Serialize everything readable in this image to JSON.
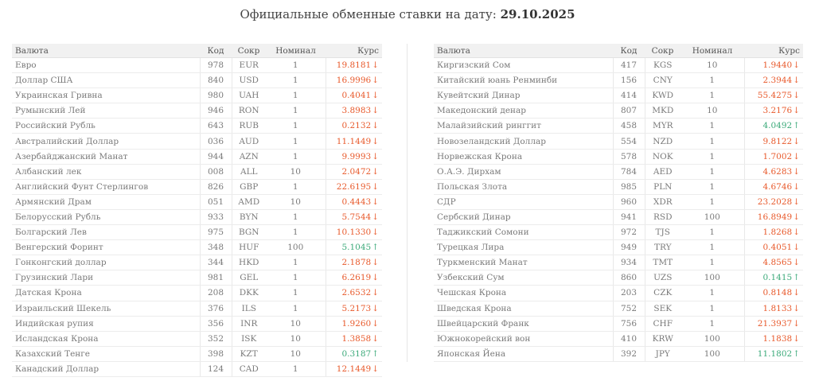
{
  "header": {
    "title_prefix": "Официальные обменные ставки на дату: ",
    "date": "29.10.2025"
  },
  "columns": {
    "name": "Валюта",
    "code": "Код",
    "abbr": "Сокр",
    "nominal": "Номинал",
    "rate": "Курс"
  },
  "colors": {
    "down": "#e85a2c",
    "up": "#3caa7a"
  },
  "icons": {
    "down": "arrow-down-icon",
    "up": "arrow-up-icon"
  },
  "left_table": [
    {
      "name": "Евро",
      "code": "978",
      "abbr": "EUR",
      "nominal": "1",
      "rate": "19.8181",
      "dir": "down",
      "arrow": "↓"
    },
    {
      "name": "Доллар США",
      "code": "840",
      "abbr": "USD",
      "nominal": "1",
      "rate": "16.9996",
      "dir": "down",
      "arrow": "↓"
    },
    {
      "name": "Украинская Гривна",
      "code": "980",
      "abbr": "UAH",
      "nominal": "1",
      "rate": "0.4041",
      "dir": "down",
      "arrow": "↓"
    },
    {
      "name": "Румынский Лей",
      "code": "946",
      "abbr": "RON",
      "nominal": "1",
      "rate": "3.8983",
      "dir": "down",
      "arrow": "↓"
    },
    {
      "name": "Российский Рубль",
      "code": "643",
      "abbr": "RUB",
      "nominal": "1",
      "rate": "0.2132",
      "dir": "down",
      "arrow": "↓"
    },
    {
      "name": "Австралийский Доллар",
      "code": "036",
      "abbr": "AUD",
      "nominal": "1",
      "rate": "11.1449",
      "dir": "down",
      "arrow": "↓"
    },
    {
      "name": "Азербайджанский Манат",
      "code": "944",
      "abbr": "AZN",
      "nominal": "1",
      "rate": "9.9993",
      "dir": "down",
      "arrow": "↓"
    },
    {
      "name": "Албанский лек",
      "code": "008",
      "abbr": "ALL",
      "nominal": "10",
      "rate": "2.0472",
      "dir": "down",
      "arrow": "↓"
    },
    {
      "name": "Английский Фунт Стерлингов",
      "code": "826",
      "abbr": "GBP",
      "nominal": "1",
      "rate": "22.6195",
      "dir": "down",
      "arrow": "↓"
    },
    {
      "name": "Армянский Драм",
      "code": "051",
      "abbr": "AMD",
      "nominal": "10",
      "rate": "0.4443",
      "dir": "down",
      "arrow": "↓"
    },
    {
      "name": "Белорусский Рубль",
      "code": "933",
      "abbr": "BYN",
      "nominal": "1",
      "rate": "5.7544",
      "dir": "down",
      "arrow": "↓"
    },
    {
      "name": "Болгарский Лев",
      "code": "975",
      "abbr": "BGN",
      "nominal": "1",
      "rate": "10.1330",
      "dir": "down",
      "arrow": "↓"
    },
    {
      "name": "Венгерский Форинт",
      "code": "348",
      "abbr": "HUF",
      "nominal": "100",
      "rate": "5.1045",
      "dir": "up",
      "arrow": "↑"
    },
    {
      "name": "Гонконгский доллар",
      "code": "344",
      "abbr": "HKD",
      "nominal": "1",
      "rate": "2.1878",
      "dir": "down",
      "arrow": "↓"
    },
    {
      "name": "Грузинский Лари",
      "code": "981",
      "abbr": "GEL",
      "nominal": "1",
      "rate": "6.2619",
      "dir": "down",
      "arrow": "↓"
    },
    {
      "name": "Датская Крона",
      "code": "208",
      "abbr": "DKK",
      "nominal": "1",
      "rate": "2.6532",
      "dir": "down",
      "arrow": "↓"
    },
    {
      "name": "Израильский Шекель",
      "code": "376",
      "abbr": "ILS",
      "nominal": "1",
      "rate": "5.2173",
      "dir": "down",
      "arrow": "↓"
    },
    {
      "name": "Индийская рупия",
      "code": "356",
      "abbr": "INR",
      "nominal": "10",
      "rate": "1.9260",
      "dir": "down",
      "arrow": "↓"
    },
    {
      "name": "Исландская Крона",
      "code": "352",
      "abbr": "ISK",
      "nominal": "10",
      "rate": "1.3858",
      "dir": "down",
      "arrow": "↓"
    },
    {
      "name": "Казахский Тенге",
      "code": "398",
      "abbr": "KZT",
      "nominal": "10",
      "rate": "0.3187",
      "dir": "up",
      "arrow": "↑"
    },
    {
      "name": "Канадский Доллар",
      "code": "124",
      "abbr": "CAD",
      "nominal": "1",
      "rate": "12.1449",
      "dir": "down",
      "arrow": "↓"
    }
  ],
  "right_table": [
    {
      "name": "Киргизский Сом",
      "code": "417",
      "abbr": "KGS",
      "nominal": "10",
      "rate": "1.9440",
      "dir": "down",
      "arrow": "↓"
    },
    {
      "name": "Китайский юань Ренминби",
      "code": "156",
      "abbr": "CNY",
      "nominal": "1",
      "rate": "2.3944",
      "dir": "down",
      "arrow": "↓"
    },
    {
      "name": "Кувейтский Динар",
      "code": "414",
      "abbr": "KWD",
      "nominal": "1",
      "rate": "55.4275",
      "dir": "down",
      "arrow": "↓"
    },
    {
      "name": "Македонский денар",
      "code": "807",
      "abbr": "MKD",
      "nominal": "10",
      "rate": "3.2176",
      "dir": "down",
      "arrow": "↓"
    },
    {
      "name": "Малайзийский ринггит",
      "code": "458",
      "abbr": "MYR",
      "nominal": "1",
      "rate": "4.0492",
      "dir": "up",
      "arrow": "↑"
    },
    {
      "name": "Новозеландский Доллар",
      "code": "554",
      "abbr": "NZD",
      "nominal": "1",
      "rate": "9.8122",
      "dir": "down",
      "arrow": "↓"
    },
    {
      "name": "Норвежская Крона",
      "code": "578",
      "abbr": "NOK",
      "nominal": "1",
      "rate": "1.7002",
      "dir": "down",
      "arrow": "↓"
    },
    {
      "name": "О.А.Э. Дирхам",
      "code": "784",
      "abbr": "AED",
      "nominal": "1",
      "rate": "4.6283",
      "dir": "down",
      "arrow": "↓"
    },
    {
      "name": "Польская Злота",
      "code": "985",
      "abbr": "PLN",
      "nominal": "1",
      "rate": "4.6746",
      "dir": "down",
      "arrow": "↓"
    },
    {
      "name": "СДР",
      "code": "960",
      "abbr": "XDR",
      "nominal": "1",
      "rate": "23.2028",
      "dir": "down",
      "arrow": "↓"
    },
    {
      "name": "Сербский Динар",
      "code": "941",
      "abbr": "RSD",
      "nominal": "100",
      "rate": "16.8949",
      "dir": "down",
      "arrow": "↓"
    },
    {
      "name": "Таджикский Сомони",
      "code": "972",
      "abbr": "TJS",
      "nominal": "1",
      "rate": "1.8268",
      "dir": "down",
      "arrow": "↓"
    },
    {
      "name": "Турецкая Лира",
      "code": "949",
      "abbr": "TRY",
      "nominal": "1",
      "rate": "0.4051",
      "dir": "down",
      "arrow": "↓"
    },
    {
      "name": "Туркменский Манат",
      "code": "934",
      "abbr": "TMT",
      "nominal": "1",
      "rate": "4.8565",
      "dir": "down",
      "arrow": "↓"
    },
    {
      "name": "Узбекский Сум",
      "code": "860",
      "abbr": "UZS",
      "nominal": "100",
      "rate": "0.1415",
      "dir": "up",
      "arrow": "↑"
    },
    {
      "name": "Чешская Крона",
      "code": "203",
      "abbr": "CZK",
      "nominal": "1",
      "rate": "0.8148",
      "dir": "down",
      "arrow": "↓"
    },
    {
      "name": "Шведская Крона",
      "code": "752",
      "abbr": "SEK",
      "nominal": "1",
      "rate": "1.8133",
      "dir": "down",
      "arrow": "↓"
    },
    {
      "name": "Швейцарский Франк",
      "code": "756",
      "abbr": "CHF",
      "nominal": "1",
      "rate": "21.3937",
      "dir": "down",
      "arrow": "↓"
    },
    {
      "name": "Южнокорейский вон",
      "code": "410",
      "abbr": "KRW",
      "nominal": "100",
      "rate": "1.1838",
      "dir": "down",
      "arrow": "↓"
    },
    {
      "name": "Японская Йена",
      "code": "392",
      "abbr": "JPY",
      "nominal": "100",
      "rate": "11.1802",
      "dir": "up",
      "arrow": "↑"
    }
  ]
}
